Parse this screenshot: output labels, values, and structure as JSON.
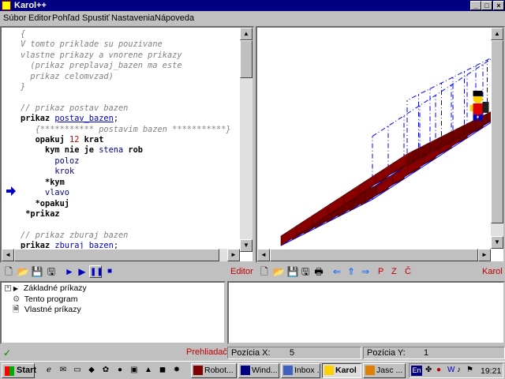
{
  "window": {
    "title": "Karol++"
  },
  "menu": [
    "Súbor",
    "Editor",
    "Pohľad",
    "Spustiť",
    "Nastavenia",
    "Nápoveda"
  ],
  "code_lines": [
    [
      {
        "t": "{",
        "c": "cm"
      }
    ],
    [
      {
        "t": "V tomto priklade su pouzivane",
        "c": "cm"
      }
    ],
    [
      {
        "t": "vlastne prikazy a vnorene prikazy",
        "c": "cm"
      }
    ],
    [
      {
        "t": "  (prikaz preplavaj_bazen ma este",
        "c": "cm"
      }
    ],
    [
      {
        "t": "  prikaz celomvzad)",
        "c": "cm"
      }
    ],
    [
      {
        "t": "}",
        "c": "cm"
      }
    ],
    [
      {
        "t": "",
        "c": ""
      }
    ],
    [
      {
        "t": "// prikaz postav bazen",
        "c": "cm"
      }
    ],
    [
      {
        "t": "prikaz ",
        "c": "kw"
      },
      {
        "t": "postav_bazen",
        "c": "lnk"
      },
      {
        "t": ";",
        "c": ""
      }
    ],
    [
      {
        "t": "   {*********** postavim bazen ***********}",
        "c": "cm"
      }
    ],
    [
      {
        "t": "   opakuj ",
        "c": "kw"
      },
      {
        "t": "12",
        "c": "num"
      },
      {
        "t": " krat",
        "c": "kw"
      }
    ],
    [
      {
        "t": "     kym nie je ",
        "c": "kw"
      },
      {
        "t": "stena",
        "c": "id"
      },
      {
        "t": " rob",
        "c": "kw"
      }
    ],
    [
      {
        "t": "       poloz",
        "c": "id"
      }
    ],
    [
      {
        "t": "       krok",
        "c": "id"
      }
    ],
    [
      {
        "t": "     *kym",
        "c": "kw"
      }
    ],
    [
      {
        "t": "     vlavo",
        "c": "id"
      }
    ],
    [
      {
        "t": "   *opakuj",
        "c": "kw"
      }
    ],
    [
      {
        "t": " *prikaz",
        "c": "kw"
      }
    ],
    [
      {
        "t": "",
        "c": ""
      }
    ],
    [
      {
        "t": "// prikaz zburaj bazen",
        "c": "cm"
      }
    ],
    [
      {
        "t": "prikaz ",
        "c": "kw"
      },
      {
        "t": "zburaj_bazen",
        "c": "lnk"
      },
      {
        "t": ";",
        "c": ""
      }
    ]
  ],
  "editor_toolbar": {
    "label": "Editor"
  },
  "karol_toolbar": {
    "label": "Karol",
    "p": "P",
    "z": "Z",
    "c": "Č"
  },
  "tree": [
    {
      "label": "Základné príkazy",
      "icon": "triangle-icon"
    },
    {
      "label": "Tento program",
      "icon": "gear-icon"
    },
    {
      "label": "Vlastné príkazy",
      "icon": "document-icon"
    }
  ],
  "status": {
    "preview": "Prehliadač",
    "posx_label": "Pozícia X:",
    "posx": "5",
    "posy_label": "Pozícia Y:",
    "posy": "1"
  },
  "taskbar": {
    "start": "Start",
    "tasks": [
      "Robot...",
      "Wind...",
      "Inbox ...",
      "Karol",
      "Jasc ..."
    ],
    "lang": "En",
    "clock": "19:21"
  },
  "colors": {
    "title": "#000080",
    "brick": "#b00000",
    "water_grid": "#0000ff",
    "accent": "#c00000"
  }
}
